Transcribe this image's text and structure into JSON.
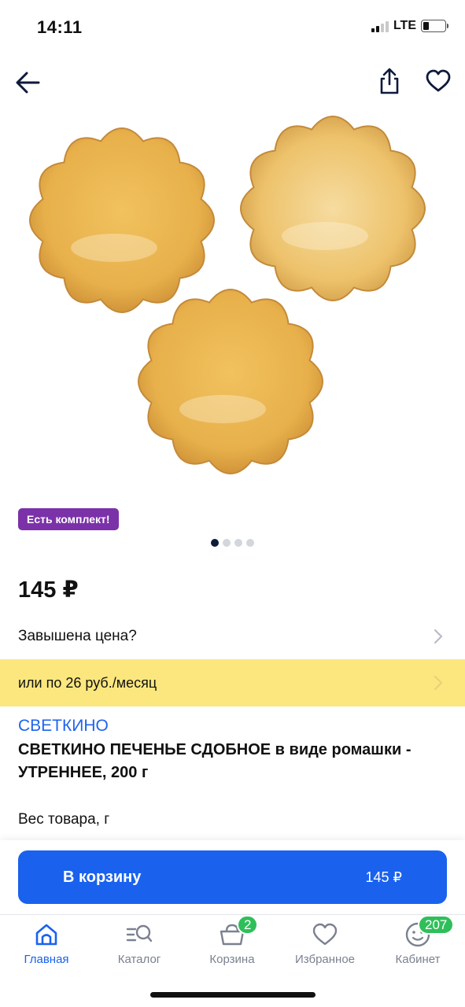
{
  "status_bar": {
    "time": "14:11",
    "network": "LTE",
    "signal_bars_on": 2,
    "signal_bars_total": 4
  },
  "top_nav": {
    "back_icon": "arrow-left-icon",
    "share_icon": "share-icon",
    "favorite_icon": "heart-icon"
  },
  "product": {
    "image_alt": "cookie-flower-image",
    "badge": "Есть комплект!",
    "gallery": {
      "count": 4,
      "active": 1
    },
    "price": "145 ₽",
    "overprice_link": "Завышена цена?",
    "installment": "или по 26 руб./месяц",
    "brand": "СВЕТКИНО",
    "title_bold": "СВЕТКИНО ПЕЧЕНЬЕ СДОБНОЕ",
    "title_rest": " в виде ромашки - УТРЕННЕЕ, 200 г",
    "weight_label": "Вес товара, г"
  },
  "cart_button": {
    "label": "В корзину",
    "price": "145 ₽"
  },
  "tabbar": {
    "items": [
      {
        "label": "Главная",
        "icon": "home-icon",
        "active": true
      },
      {
        "label": "Каталог",
        "icon": "catalog-search-icon"
      },
      {
        "label": "Корзина",
        "icon": "basket-icon",
        "badge": "2"
      },
      {
        "label": "Избранное",
        "icon": "heart-icon"
      },
      {
        "label": "Кабинет",
        "icon": "smiley-icon",
        "badge": "207"
      }
    ]
  },
  "colors": {
    "accent": "#1a62ee",
    "badge_purple": "#7b32a8",
    "installment_bg": "#fbe77e",
    "badge_green": "#2fbf5a",
    "brand_blue": "#1f63f0"
  }
}
